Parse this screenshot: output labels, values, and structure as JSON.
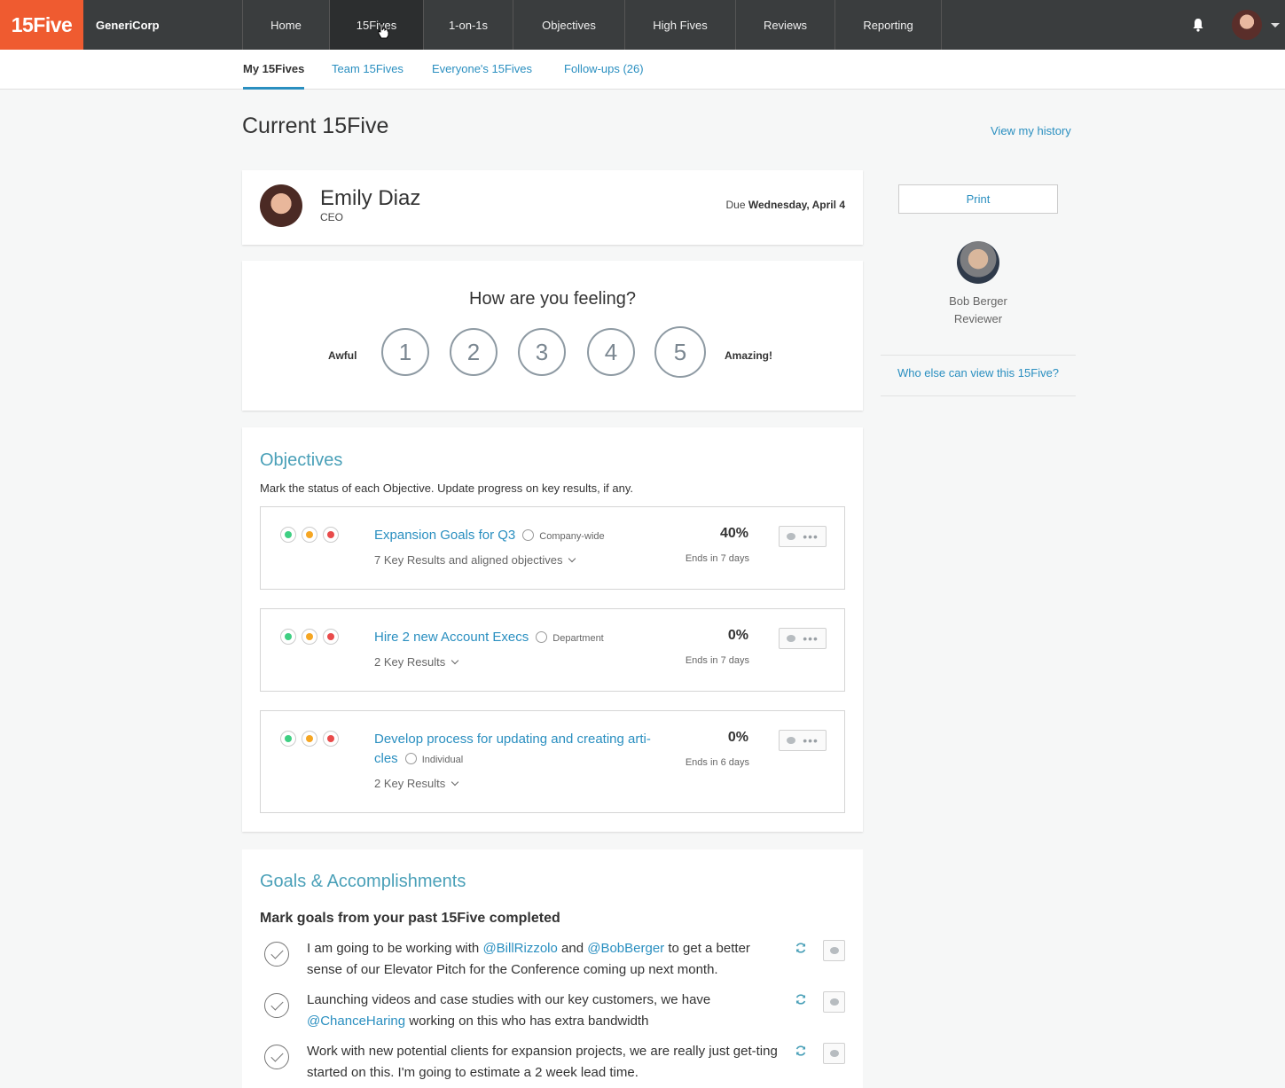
{
  "nav": {
    "logo": "15Five",
    "company": "GeneriCorp",
    "items": [
      {
        "label": "Home",
        "active": false
      },
      {
        "label": "15Fives",
        "active": true
      },
      {
        "label": "1-on-1s",
        "active": false
      },
      {
        "label": "Objectives",
        "active": false
      },
      {
        "label": "High Fives",
        "active": false
      },
      {
        "label": "Reviews",
        "active": false
      },
      {
        "label": "Reporting",
        "active": false
      }
    ]
  },
  "subnav": {
    "tabs": [
      {
        "label": "My 15Fives",
        "active": true
      },
      {
        "label": "Team 15Fives",
        "active": false
      },
      {
        "label": "Everyone's 15Fives",
        "active": false
      },
      {
        "label": "Follow-ups (26)",
        "active": false
      }
    ]
  },
  "page": {
    "title": "Current 15Five",
    "history_link": "View my history"
  },
  "person": {
    "name": "Emily Diaz",
    "role": "CEO",
    "due_prefix": "Due",
    "due_date": "Wednesday, April 4"
  },
  "feeling": {
    "question": "How are you feeling?",
    "low_label": "Awful",
    "high_label": "Amazing!",
    "options": [
      "1",
      "2",
      "3",
      "4",
      "5"
    ]
  },
  "objectives": {
    "title": "Objectives",
    "description": "Mark the status of each Objective. Update progress on key results, if any.",
    "status_colors": [
      "#3ecf82",
      "#f5a623",
      "#e94b4b"
    ],
    "items": [
      {
        "title": "Expansion Goals for Q3",
        "scope": "Company-wide",
        "key_results": "7 Key Results and aligned objectives",
        "percent": "40%",
        "ends": "Ends in 7 days"
      },
      {
        "title": "Hire 2 new Account Execs",
        "scope": "Department",
        "key_results": "2 Key Results",
        "percent": "0%",
        "ends": "Ends in 7 days"
      },
      {
        "title": "Develop process for updating and creating arti-",
        "title_line2": "cles",
        "scope": "Individual",
        "key_results": "2 Key Results",
        "percent": "0%",
        "ends": "Ends in 6 days"
      }
    ]
  },
  "goals": {
    "title": "Goals & Accomplishments",
    "subtitle": "Mark goals from your past 15Five completed",
    "items": [
      {
        "t1": "I am going to be working with ",
        "m1": "@BillRizzolo",
        "t2": " and ",
        "m2": "@BobBerger",
        "t3": " to get a better sense of our Elevator Pitch for the Conference coming up next month."
      },
      {
        "t1": "Launching videos and case studies with our key customers, we have ",
        "m1": "@ChanceHaring",
        "t2": " working on this who has extra bandwidth",
        "m2": "",
        "t3": ""
      },
      {
        "t1": "Work with new potential clients for expansion projects, we are really just get-ting started on this. I'm going to estimate a 2 week lead time.",
        "m1": "",
        "t2": "",
        "m2": "",
        "t3": ""
      }
    ]
  },
  "sidebar": {
    "print_label": "Print",
    "reviewer_name": "Bob Berger",
    "reviewer_role": "Reviewer",
    "who_link": "Who else can view this 15Five?"
  }
}
